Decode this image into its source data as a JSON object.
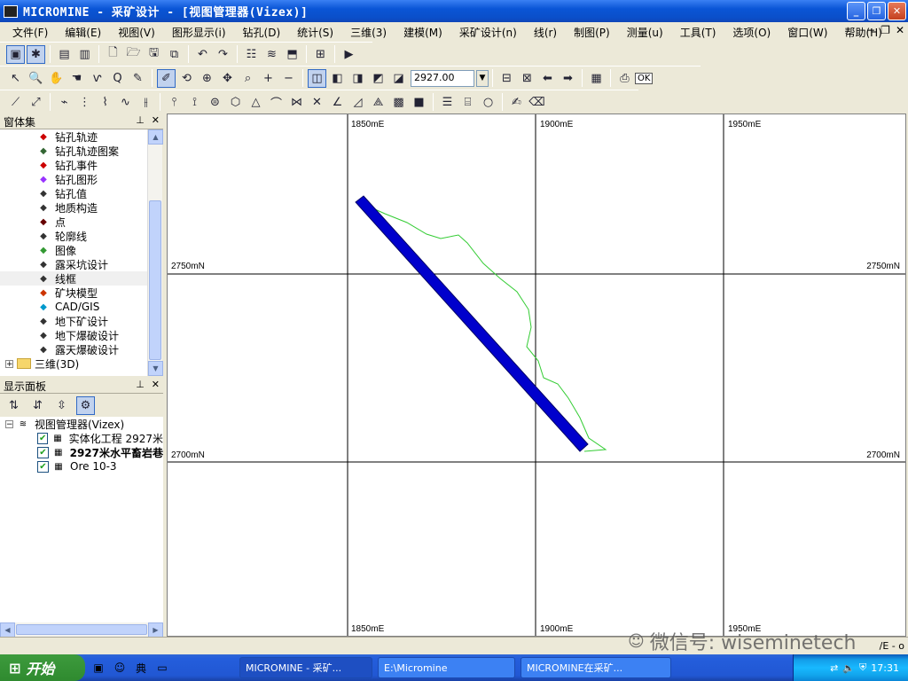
{
  "window": {
    "title": "MICROMINE - 采矿设计 - [视图管理器(Vizex)]"
  },
  "menu": [
    "文件(F)",
    "编辑(E)",
    "视图(V)",
    "图形显示(i)",
    "钻孔(D)",
    "统计(S)",
    "三维(3)",
    "建模(M)",
    "采矿设计(n)",
    "线(r)",
    "制图(P)",
    "测量(u)",
    "工具(T)",
    "选项(O)",
    "窗口(W)",
    "帮助(H)"
  ],
  "toolbar": {
    "elevation_value": "2927.00",
    "ok_label": "OK"
  },
  "left_panel": {
    "title": "窗体集",
    "tree_items": [
      "钻孔轨迹",
      "钻孔轨迹图案",
      "钻孔事件",
      "钻孔图形",
      "钻孔值",
      "地质构造",
      "点",
      "轮廓线",
      "图像",
      "露采坑设计",
      "线框",
      "矿块模型",
      "CAD/GIS",
      "地下矿设计",
      "地下爆破设计",
      "露天爆破设计"
    ],
    "tree_icons": [
      "drillhole-trace-icon",
      "drillhole-pattern-icon",
      "drillhole-event-icon",
      "drillhole-graph-icon",
      "drillhole-value-icon",
      "geology-structure-icon",
      "point-icon",
      "contour-icon",
      "image-icon",
      "pit-design-icon",
      "wireframe-icon",
      "block-model-icon",
      "cad-gis-icon",
      "underground-design-icon",
      "underground-blast-icon",
      "open-pit-blast-icon"
    ],
    "tree_folder": "三维(3D)",
    "selected": "线框"
  },
  "display_panel": {
    "title": "显示面板",
    "root": "视图管理器(Vizex)",
    "layers": [
      {
        "label": "实体化工程 2927米",
        "checked": true,
        "bold": false
      },
      {
        "label": "2927米水平畜岩巷",
        "checked": true,
        "bold": true
      },
      {
        "label": "Ore 10-3",
        "checked": true,
        "bold": false
      }
    ]
  },
  "viewport": {
    "grid_labels_x": [
      "1850mE",
      "1900mE",
      "1950mE"
    ],
    "grid_labels_y": [
      "2750mN",
      "2700mN"
    ],
    "colors": {
      "tunnel": "#0000cc",
      "outline": "#33cc33",
      "grid": "#000000"
    }
  },
  "statusbar": {
    "text": "/E - o"
  },
  "taskbar": {
    "start": "开始",
    "tasks": [
      "MICROMINE - 采矿...",
      "E:\\Micromine",
      "MICROMINE在采矿..."
    ],
    "clock": "17:31"
  },
  "watermark": "微信号: wiseminetech"
}
